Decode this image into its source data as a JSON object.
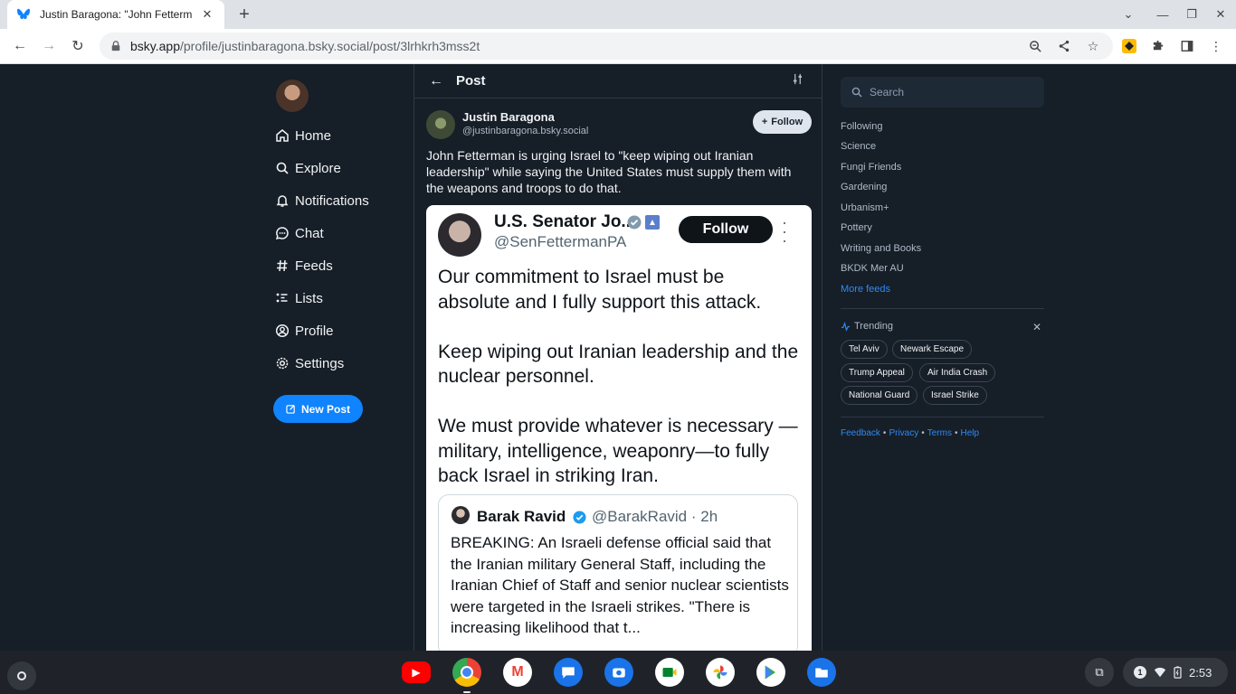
{
  "browser": {
    "tab_title": "Justin Baragona: \"John Fetterm",
    "url_host": "bsky.app",
    "url_path": "/profile/justinbaragona.bsky.social/post/3lrhkrh3mss2t"
  },
  "nav": {
    "items": [
      {
        "label": "Home",
        "icon": "home-icon"
      },
      {
        "label": "Explore",
        "icon": "search-icon"
      },
      {
        "label": "Notifications",
        "icon": "bell-icon"
      },
      {
        "label": "Chat",
        "icon": "chat-icon"
      },
      {
        "label": "Feeds",
        "icon": "hash-icon"
      },
      {
        "label": "Lists",
        "icon": "list-icon"
      },
      {
        "label": "Profile",
        "icon": "profile-icon"
      },
      {
        "label": "Settings",
        "icon": "gear-icon"
      }
    ],
    "new_post": "New Post"
  },
  "post": {
    "header": "Post",
    "author_name": "Justin Baragona",
    "author_handle": "@justinbaragona.bsky.social",
    "follow_label": "Follow",
    "text": "John Fetterman is urging Israel to \"keep wiping out Iranian leadership\" while saying the United States must supply them with the weapons and troops to do that."
  },
  "embed": {
    "name": "U.S. Senator Jo...",
    "handle": "@SenFettermanPA",
    "follow_label": "Follow",
    "paragraphs": [
      "Our commitment to Israel must be absolute and I fully support this attack.",
      "Keep wiping out Iranian leadership and the nuclear personnel.",
      "We must provide whatever is necessary —military, intelligence, weaponry—to fully back Israel in striking Iran."
    ],
    "quote": {
      "name": "Barak Ravid",
      "handle": "@BarakRavid · 2h",
      "text": "BREAKING: An Israeli defense official said that the Iranian military General Staff, including the Iranian Chief of Staff and senior nuclear scientists were targeted in the Israeli strikes. \"There is increasing likelihood that t..."
    }
  },
  "sidebar": {
    "search_placeholder": "Search",
    "feeds": [
      "Following",
      "Science",
      "Fungi Friends",
      "Gardening",
      "Urbanism+",
      "Pottery",
      "Writing and Books",
      "BKDK Mer AU"
    ],
    "more_feeds": "More feeds",
    "trending_title": "Trending",
    "trending": [
      "Tel Aviv",
      "Newark Escape",
      "Trump Appeal",
      "Air India Crash",
      "National Guard",
      "Israel Strike"
    ],
    "footer": [
      "Feedback",
      "Privacy",
      "Terms",
      "Help"
    ]
  },
  "shelf": {
    "apps": [
      "youtube-icon",
      "chrome-icon",
      "gmail-icon",
      "messages-icon",
      "camera-icon",
      "meet-icon",
      "photos-icon",
      "play-store-icon",
      "files-icon"
    ],
    "notification_count": "1",
    "time": "2:53"
  },
  "colors": {
    "bsky_blue": "#1083fe",
    "page_bg": "#161e27"
  }
}
